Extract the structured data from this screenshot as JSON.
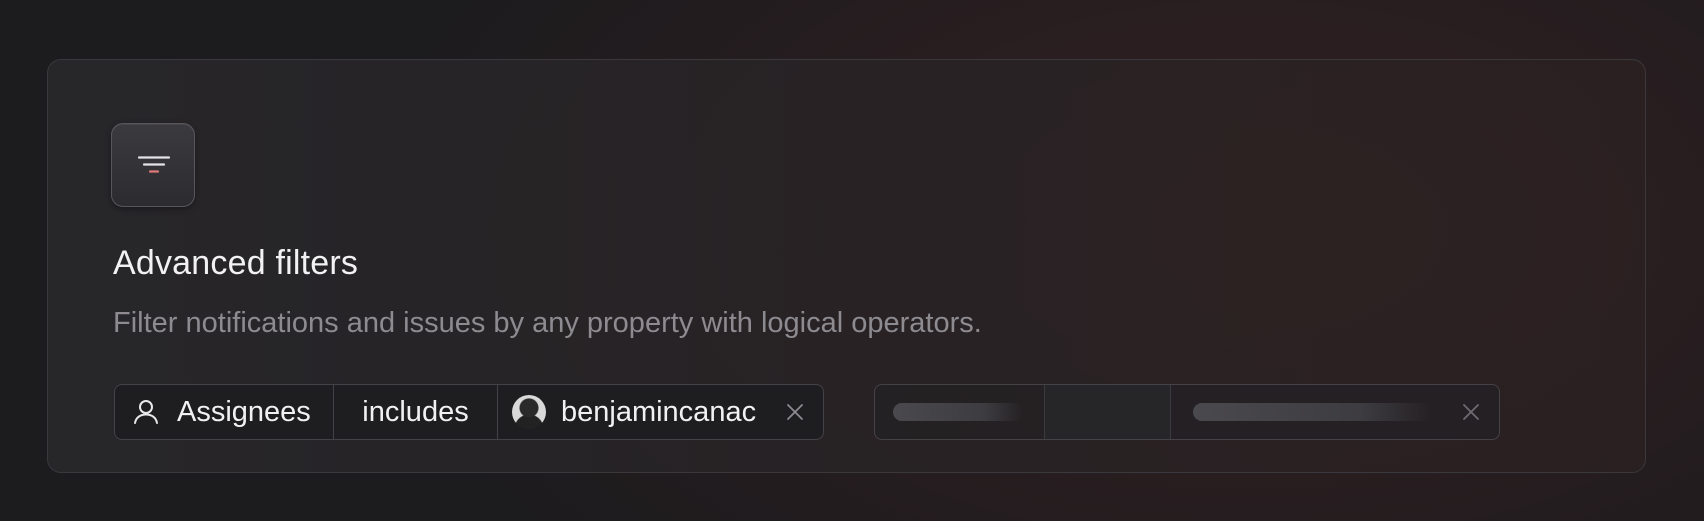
{
  "feature": {
    "icon": "filter-icon",
    "title": "Advanced filters",
    "description": "Filter notifications and issues by any property with logical operators."
  },
  "filter": {
    "property_icon": "user-icon",
    "property": "Assignees",
    "operator": "includes",
    "value_avatar": "avatar",
    "value": "benjamincanac",
    "remove_icon": "close-icon"
  },
  "placeholder_filter": {
    "remove_icon": "close-icon"
  },
  "colors": {
    "accent": "#e07a78",
    "title": "#f2f1f3",
    "muted": "#8d8b90"
  }
}
